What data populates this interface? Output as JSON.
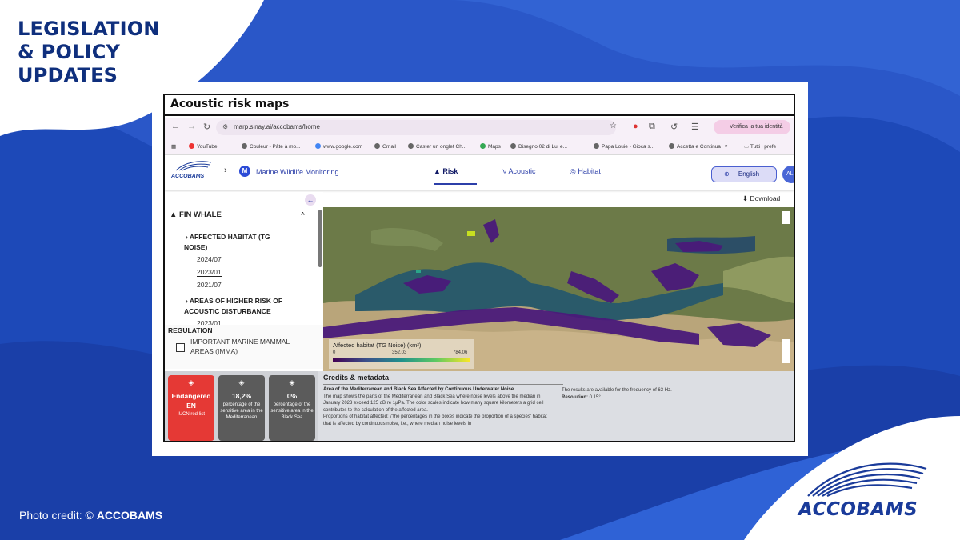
{
  "post": {
    "headline_lines": [
      "LEGISLATION",
      "& POLICY",
      "UPDATES"
    ],
    "photo_credit_prefix": "Photo credit: ©",
    "photo_credit_owner": "ACCOBAMS",
    "logo_text": "ACCOBAMS"
  },
  "screenshot": {
    "title": "Acoustic risk maps",
    "browser": {
      "url": "marp.sinay.ai/accobams/home",
      "identity_button": "Verifica la tua identità",
      "bookmarks": [
        "YouTube",
        "Couleur - Pâte à mo...",
        "www.google.com",
        "Gmail",
        "Caster un onglet Ch...",
        "Maps",
        "Disegno 02 di Lui e...",
        "Papa Louie - Gioca s...",
        "Accetta e Continua",
        "»",
        "Tutti i prefe"
      ]
    },
    "app": {
      "logo_text": "ACCOBAMS",
      "badge_letter": "M",
      "section_title": "Marine Wildlife Monitoring",
      "tabs": [
        "Risk",
        "Acoustic",
        "Habitat"
      ],
      "language": "English",
      "avatar": "AL",
      "download": "Download"
    },
    "sidebar": {
      "species": "FIN WHALE",
      "layer1": "AFFECTED HABITAT (TG",
      "layer1b": "NOISE)",
      "dates1": [
        "2024/07",
        "2023/01",
        "2021/07"
      ],
      "layer2": "AREAS OF HIGHER RISK OF",
      "layer2b": "ACOUSTIC DISTURBANCE",
      "dates2": [
        "2023/01"
      ],
      "regulation": "REGULATION",
      "imma_line1": "IMPORTANT MARINE MAMMAL",
      "imma_line2": "AREAS (IMMA)"
    },
    "legend": {
      "title": "Affected habitat (TG Noise) (km²)",
      "values": [
        "0",
        "352.03",
        "784.06"
      ]
    },
    "stats": [
      {
        "big": "Endangered",
        "sub": "EN",
        "small": "IUCN red list",
        "color": "#e53935"
      },
      {
        "big": "18,2%",
        "sub": "",
        "small": "percentage of the sensitive area in the Mediterranean",
        "color": "#5b5b5b"
      },
      {
        "big": "0%",
        "sub": "",
        "small": "percentage of the sensitive area in the Black Sea",
        "color": "#5b5b5b"
      }
    ],
    "credits": {
      "heading": "Credits & metadata",
      "bold_title": "Area of the Mediterranean and Black Sea Affected by Continuous Underwater Noise",
      "body1": "The map shows the parts of the Mediterranean and Black Sea where noise levels above the median in January 2023 exceed 125 dB re 1µPa. The color scales indicate how many square kilometers a grid cell contributes to the calculation of the affected area.",
      "body2": "Proportions of habitat affected: \\\"the percentages in the boxes indicate the proportion of a species' habitat that is affected by continuous noise, i.e., where median noise levels in",
      "right1": "The results are available for the frequency of 63 Hz.",
      "right2_label": "Resolution:",
      "right2_value": "0.15°"
    }
  },
  "colors": {
    "bg_blue": "#1d49b8",
    "brand_navy": "#0f2f7d",
    "accent": "#2c3fa9"
  }
}
